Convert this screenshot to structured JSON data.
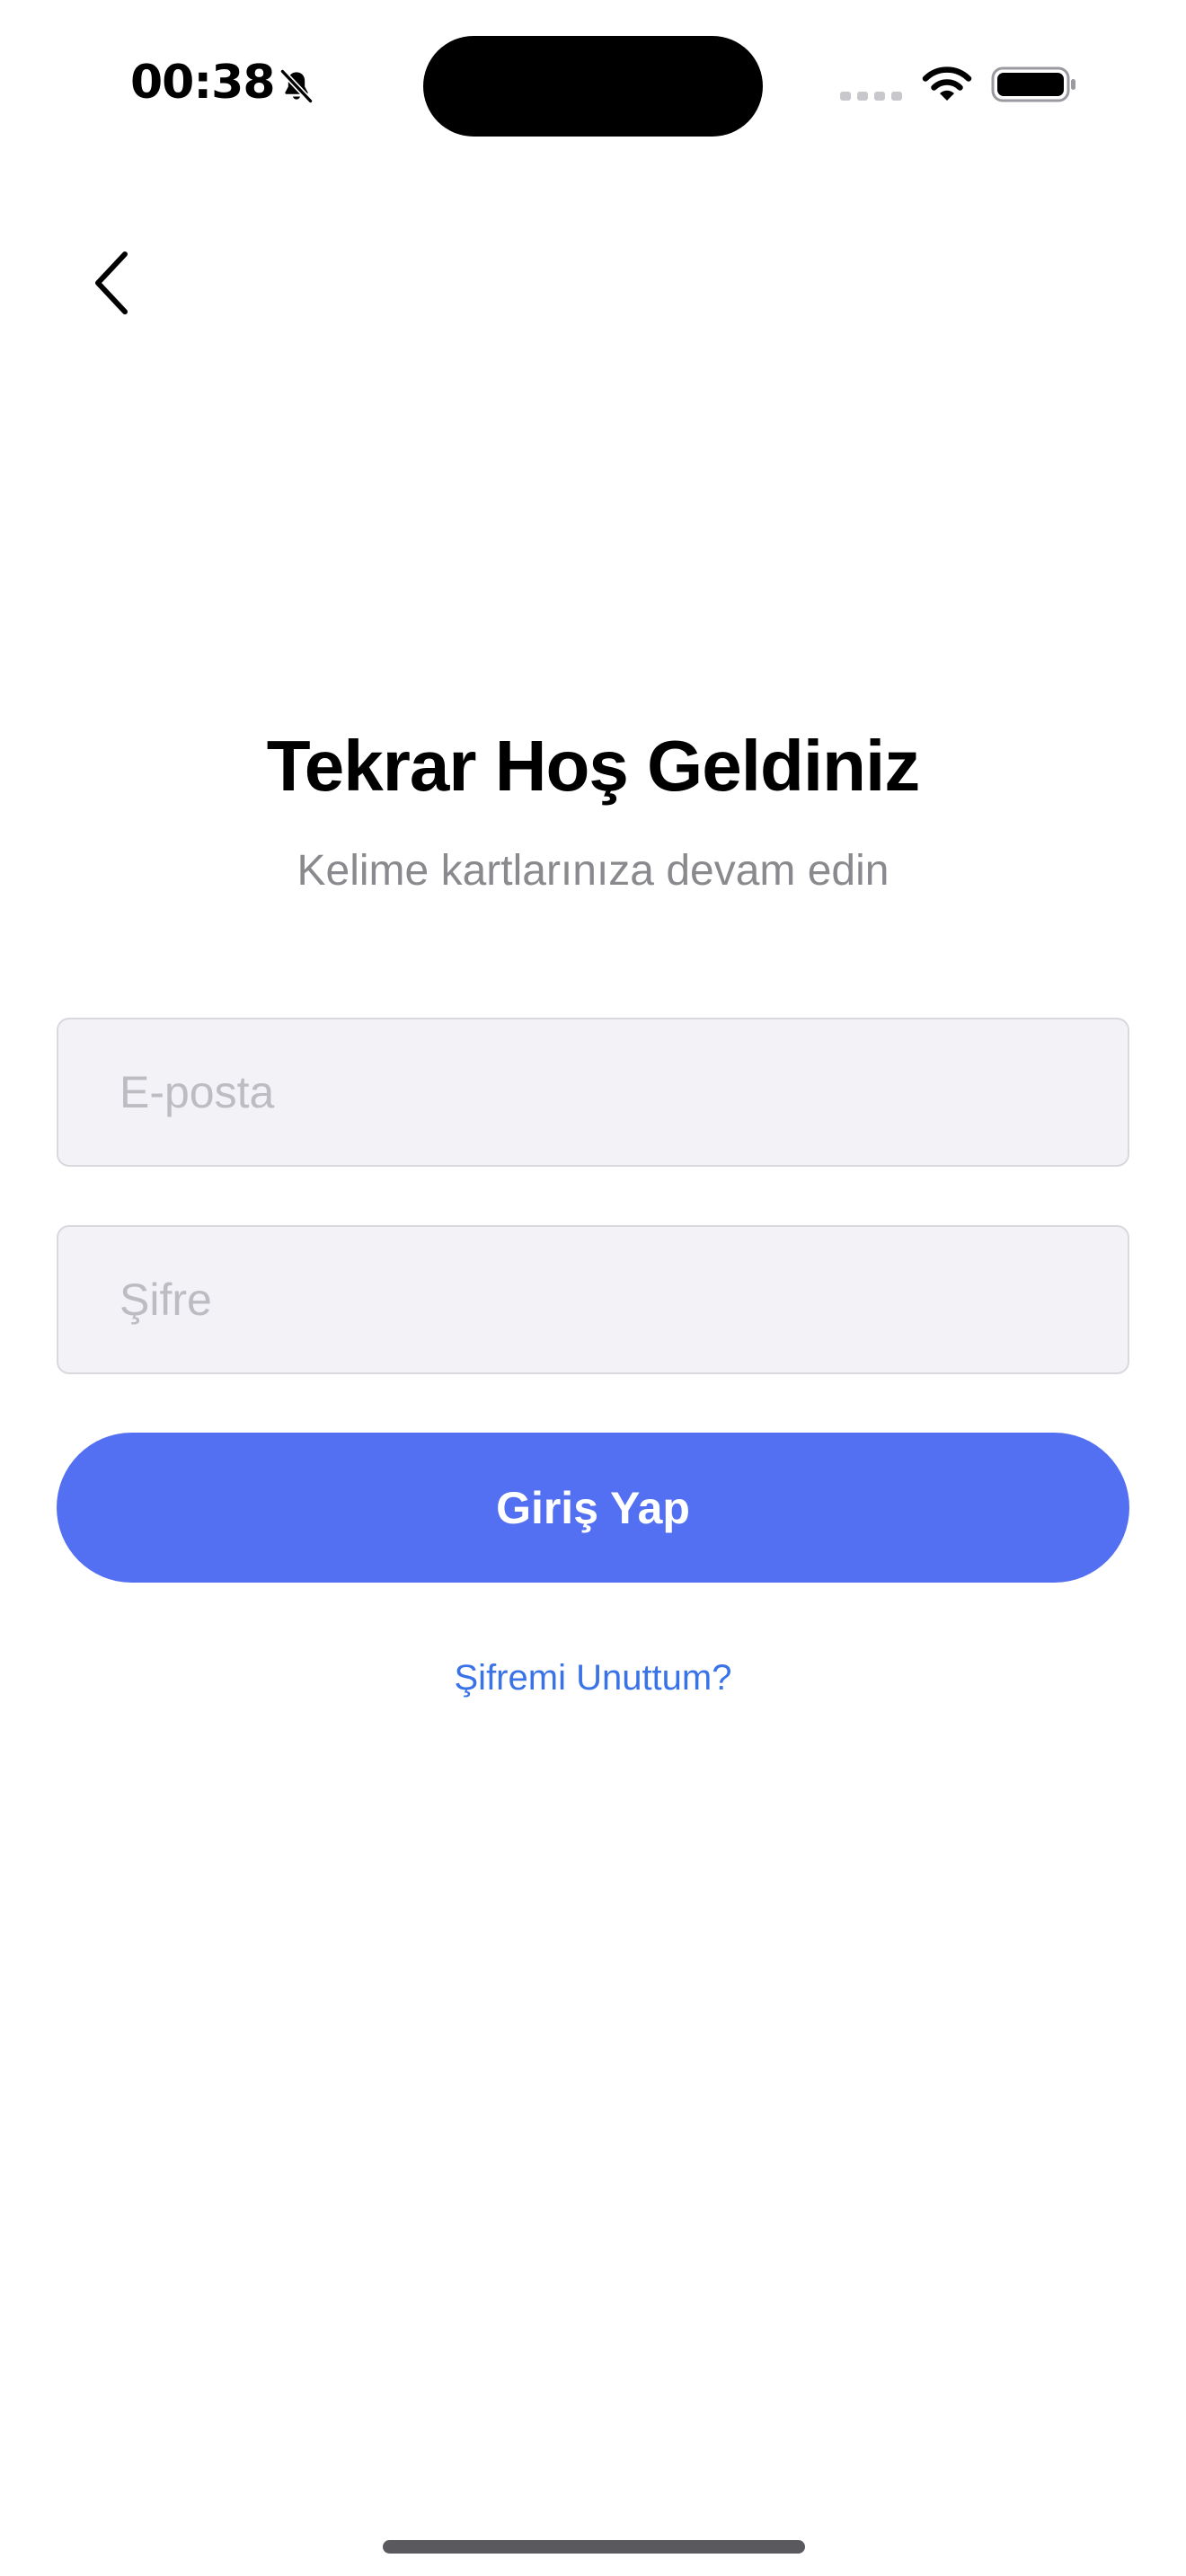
{
  "status_bar": {
    "time": "00:38",
    "icons": [
      "bell-slash-icon",
      "cellular-signal-icon",
      "wifi-icon",
      "battery-icon"
    ]
  },
  "nav": {
    "back_icon": "chevron-left-icon"
  },
  "header": {
    "title": "Tekrar Hoş Geldiniz",
    "subtitle": "Kelime kartlarınıza devam edin"
  },
  "form": {
    "email": {
      "value": "",
      "placeholder": "E-posta"
    },
    "password": {
      "value": "",
      "placeholder": "Şifre"
    },
    "login_label": "Giriş Yap",
    "forgot_label": "Şifremi Unuttum?"
  },
  "colors": {
    "accent": "#5470f2",
    "link": "#3a73e8",
    "field_background": "#f2f2f7",
    "subtitle_text": "#8a8a8e"
  }
}
